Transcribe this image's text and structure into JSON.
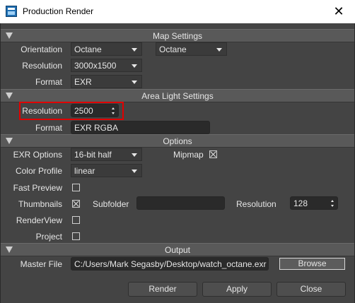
{
  "window": {
    "title": "Production Render",
    "app_icon": "render-app-icon",
    "close_icon": "close-icon"
  },
  "sections": {
    "map_settings": "Map Settings",
    "area_light_settings": "Area Light Settings",
    "options": "Options",
    "output": "Output"
  },
  "map_settings": {
    "orientation_label": "Orientation",
    "orientation_value": "Octane",
    "orientation_value_2": "Octane",
    "resolution_label": "Resolution",
    "resolution_value": "3000x1500",
    "format_label": "Format",
    "format_value": "EXR"
  },
  "area_light": {
    "resolution_label": "Resolution",
    "resolution_value": "2500",
    "format_label": "Format",
    "format_value": "EXR RGBA",
    "highlight_color": "#e00000"
  },
  "options": {
    "exr_options_label": "EXR Options",
    "exr_options_value": "16-bit half",
    "mipmap_label": "Mipmap",
    "mipmap_checked": true,
    "color_profile_label": "Color Profile",
    "color_profile_value": "linear",
    "fast_preview_label": "Fast Preview",
    "fast_preview_checked": false,
    "thumbnails_label": "Thumbnails",
    "thumbnails_checked": true,
    "subfolder_label": "Subfolder",
    "subfolder_value": "",
    "thumb_resolution_label": "Resolution",
    "thumb_resolution_value": "128",
    "renderview_label": "RenderView",
    "renderview_checked": false,
    "project_label": "Project",
    "project_checked": false
  },
  "output": {
    "master_file_label": "Master File",
    "master_file_value": "C:/Users/Mark Segasby/Desktop/watch_octane.exr",
    "browse_label": "Browse"
  },
  "buttons": {
    "render": "Render",
    "apply": "Apply",
    "close": "Close"
  }
}
